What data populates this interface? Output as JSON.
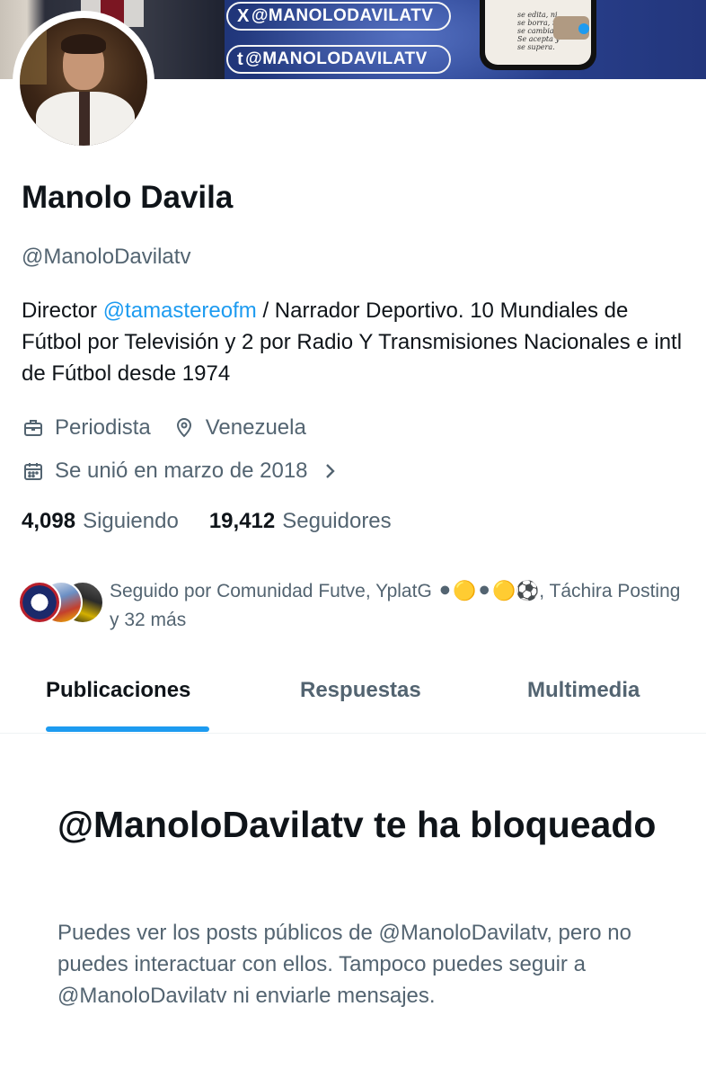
{
  "banner": {
    "x_handle": "@MANOLODAVILATV",
    "x_symbol": "X",
    "t_handle": "@MANOLODAVILATV",
    "t_symbol": "t",
    "phone_quote": "se edita, ni se borra, ni se cambia. Se acepta y se supera."
  },
  "profile": {
    "name": "Manolo Davila",
    "handle": "@ManoloDavilatv",
    "bio_prefix": "Director ",
    "bio_mention": "@tamastereofm",
    "bio_suffix": " / Narrador Deportivo. 10 Mundiales de Fútbol por Televisión y 2 por Radio Y Transmisiones Nacionales e intl de Fútbol desde 1974",
    "profession": "Periodista",
    "location": "Venezuela",
    "joined": "Se unió en marzo de 2018"
  },
  "stats": {
    "following_count": "4,098",
    "following_label": "Siguiendo",
    "followers_count": "19,412",
    "followers_label": "Seguidores"
  },
  "followed_by": {
    "text": "Seguido por Comunidad Futve, YplatG ⚫🟡⚫🟡⚽, Táchira Posting y 32 más"
  },
  "tabs": [
    {
      "label": "Publicaciones",
      "active": true
    },
    {
      "label": "Respuestas",
      "active": false
    },
    {
      "label": "Multimedia",
      "active": false
    }
  ],
  "blocked": {
    "title": "@ManoloDavilatv te ha bloqueado",
    "body": "Puedes ver los posts públicos de @ManoloDavilatv, pero no puedes interactuar con ellos. Tampoco puedes seguir a @ManoloDavilatv ni enviarle mensajes."
  },
  "colors": {
    "accent": "#1d9bf0",
    "text_primary": "#0f1419",
    "text_secondary": "#536471",
    "banner": "#23367c"
  },
  "icons": {
    "profession": "briefcase-icon",
    "location": "location-pin-icon",
    "joined": "calendar-icon",
    "joined_more": "chevron-right-icon"
  }
}
